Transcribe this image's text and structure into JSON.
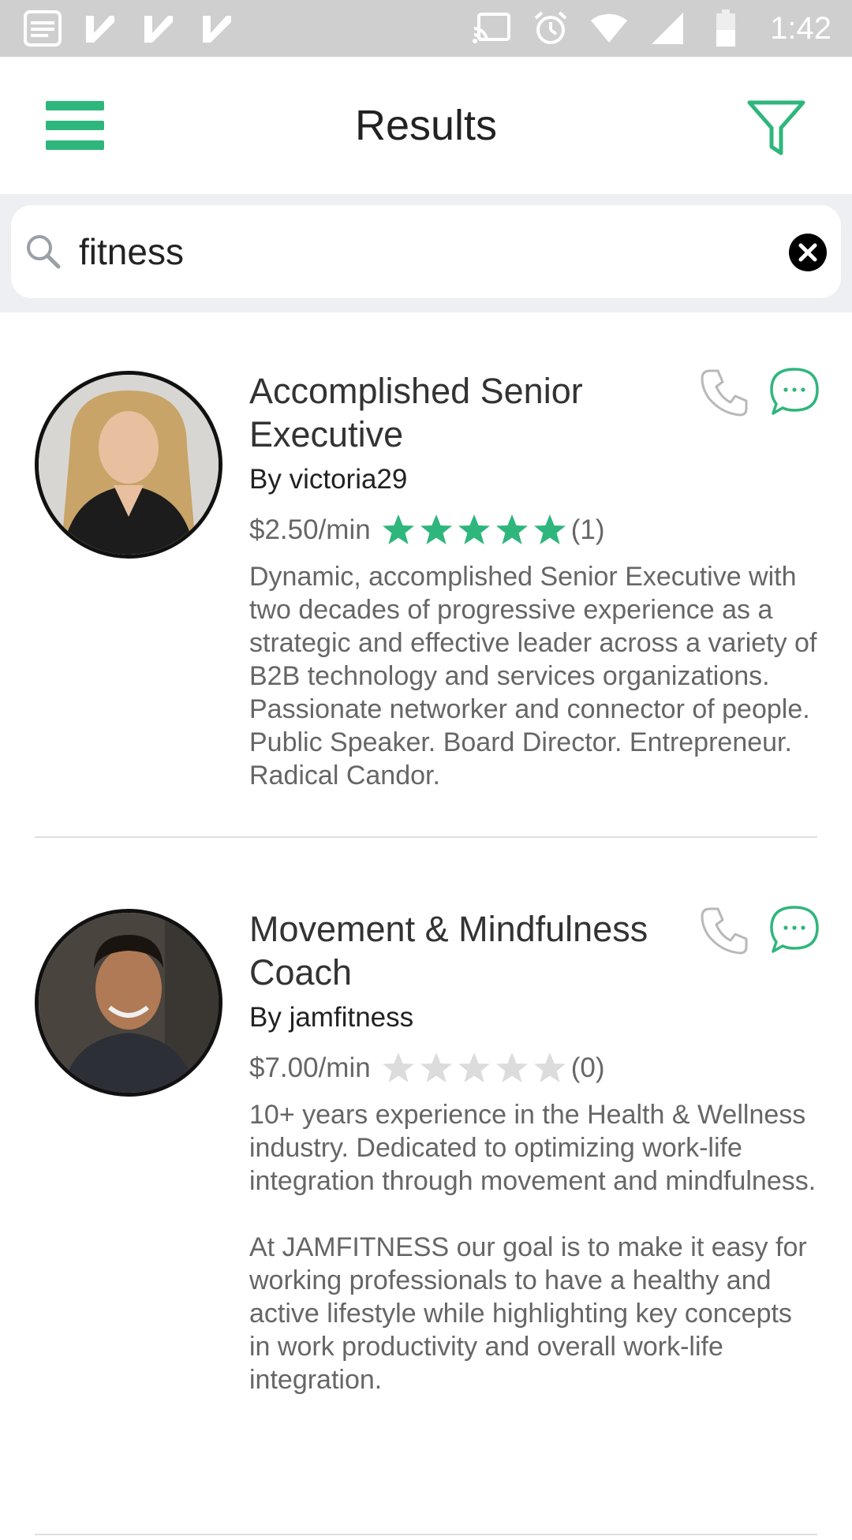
{
  "status_bar": {
    "time": "1:42",
    "left_icons": [
      "notification-icon",
      "check-icon",
      "check-icon",
      "check-icon"
    ],
    "right_icons": [
      "cast-icon",
      "alarm-icon",
      "wifi-icon",
      "signal-icon",
      "battery-icon"
    ]
  },
  "header": {
    "title": "Results",
    "accent_color": "#2fb67c"
  },
  "search": {
    "value": "fitness",
    "placeholder": ""
  },
  "results": [
    {
      "title": "Accomplished Senior Executive",
      "owner": "By victoria29",
      "price": "$2.50/min",
      "rating": 5,
      "rating_max": 5,
      "rating_count": "(1)",
      "description": "Dynamic, accomplished Senior Executive with two decades of progressive experience as a strategic and effective leader across a variety of B2B technology and services organizations. Passionate networker and connector of people. Public Speaker. Board Director. Entrepreneur. Radical Candor."
    },
    {
      "title": "Movement & Mindfulness Coach",
      "owner": "By jamfitness",
      "price": "$7.00/min",
      "rating": 0,
      "rating_max": 5,
      "rating_count": "(0)",
      "description": "10+ years experience in the Health & Wellness industry. Dedicated to optimizing work-life integration through movement and mindfulness.\n\nAt JAMFITNESS our goal is to make it easy for working professionals to have a healthy and active lifestyle while highlighting key concepts in work productivity and overall work-life integration."
    }
  ]
}
